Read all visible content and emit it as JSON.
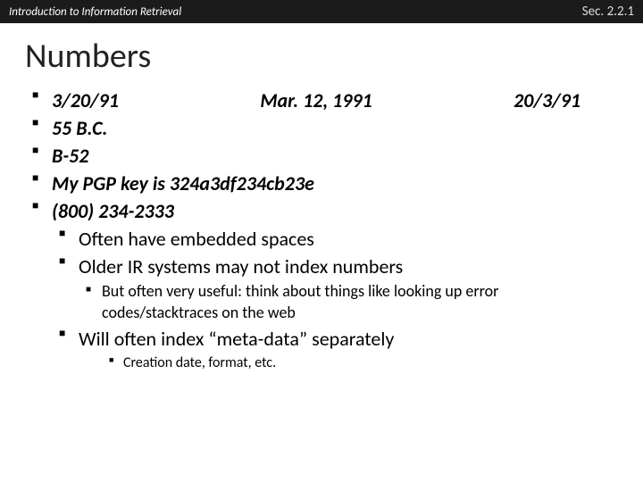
{
  "header": {
    "left": "Introduction to Information Retrieval",
    "right": "Sec. 2.2.1"
  },
  "title": "Numbers",
  "bullets": {
    "l1": {
      "a": "3/20/91",
      "b": "Mar. 12, 1991",
      "c": "20/3/91"
    },
    "l2": "55 B.C.",
    "l3": "B-52",
    "l4": "My PGP key is 324a3df234cb23e",
    "l5": "(800) 234-2333"
  },
  "sub": {
    "s1": "Often have embedded spaces",
    "s2": "Older IR systems may not index numbers",
    "s2a": "But often very useful: think about things like looking up error codes/stacktraces on the web",
    "s3_pre": "Will often index ",
    "s3_quoted": "meta-data",
    "s3_post": " separately",
    "s3a": "Creation date, format, etc."
  }
}
